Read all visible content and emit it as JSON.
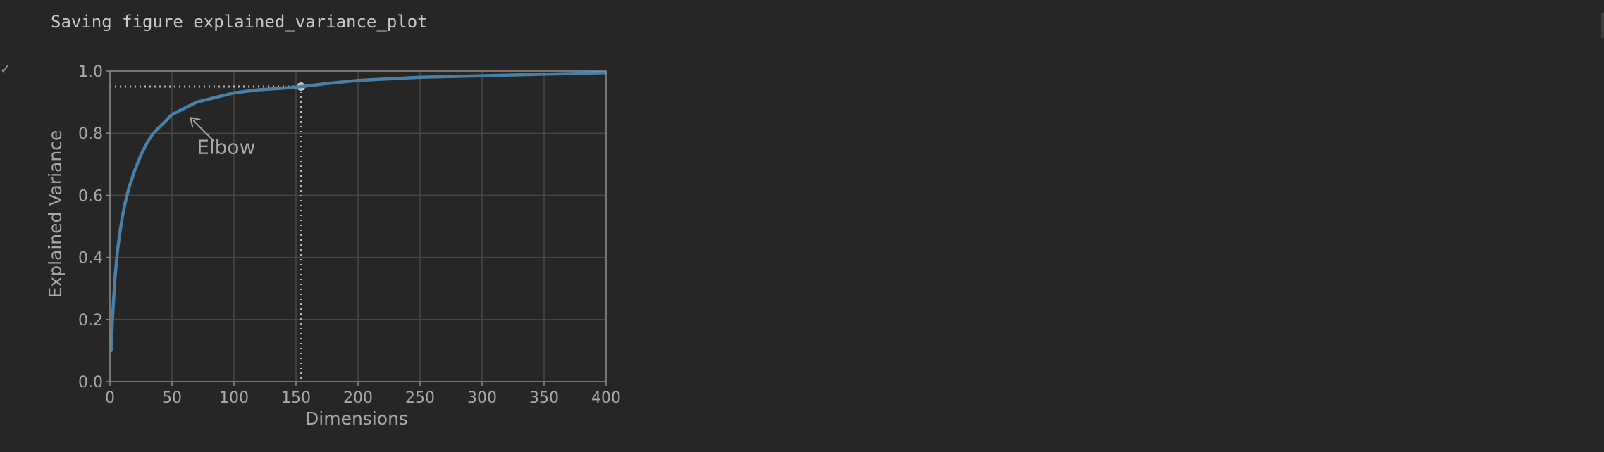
{
  "output": {
    "text": "Saving figure explained_variance_plot"
  },
  "icons": {
    "check": "check-icon"
  },
  "chart_data": {
    "type": "line",
    "title": "",
    "xlabel": "Dimensions",
    "ylabel": "Explained Variance",
    "xlim": [
      0,
      400
    ],
    "ylim": [
      0.0,
      1.0
    ],
    "xticks": [
      "0",
      "50",
      "100",
      "150",
      "200",
      "250",
      "300",
      "350",
      "400"
    ],
    "yticks": [
      "0.0",
      "0.2",
      "0.4",
      "0.6",
      "0.8",
      "1.0"
    ],
    "grid": true,
    "series": [
      {
        "color": "#4a7fa8",
        "x": [
          1,
          2,
          4,
          6,
          8,
          10,
          12,
          15,
          20,
          25,
          30,
          35,
          40,
          45,
          50,
          60,
          70,
          80,
          90,
          100,
          120,
          140,
          154,
          175,
          200,
          250,
          300,
          350,
          400
        ],
        "y": [
          0.1,
          0.2,
          0.33,
          0.42,
          0.48,
          0.53,
          0.57,
          0.62,
          0.68,
          0.73,
          0.77,
          0.8,
          0.82,
          0.84,
          0.86,
          0.88,
          0.9,
          0.91,
          0.92,
          0.93,
          0.94,
          0.945,
          0.95,
          0.96,
          0.97,
          0.98,
          0.985,
          0.99,
          0.995
        ]
      }
    ],
    "reference": {
      "x": 154,
      "y": 0.95
    },
    "annotation": {
      "text": "Elbow",
      "point": {
        "x": 65,
        "y": 0.85
      },
      "text_pos": {
        "x": 70,
        "y": 0.7
      }
    }
  }
}
